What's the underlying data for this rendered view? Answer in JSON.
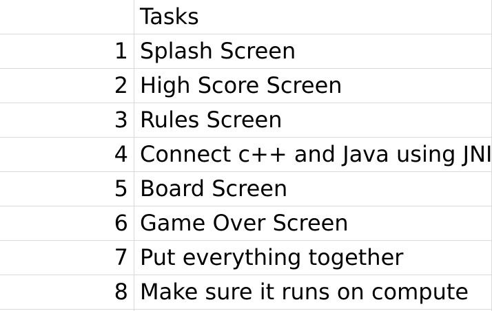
{
  "sheet": {
    "header": {
      "number": "",
      "task": "Tasks"
    },
    "rows": [
      {
        "number": "1",
        "task": "Splash Screen"
      },
      {
        "number": "2",
        "task": "High Score Screen"
      },
      {
        "number": "3",
        "task": "Rules Screen"
      },
      {
        "number": "4",
        "task": "Connect c++ and Java using JNI"
      },
      {
        "number": "5",
        "task": "Board Screen"
      },
      {
        "number": "6",
        "task": "Game Over Screen"
      },
      {
        "number": "7",
        "task": "Put everything together"
      },
      {
        "number": "8",
        "task": "Make sure it runs on compute"
      }
    ]
  }
}
